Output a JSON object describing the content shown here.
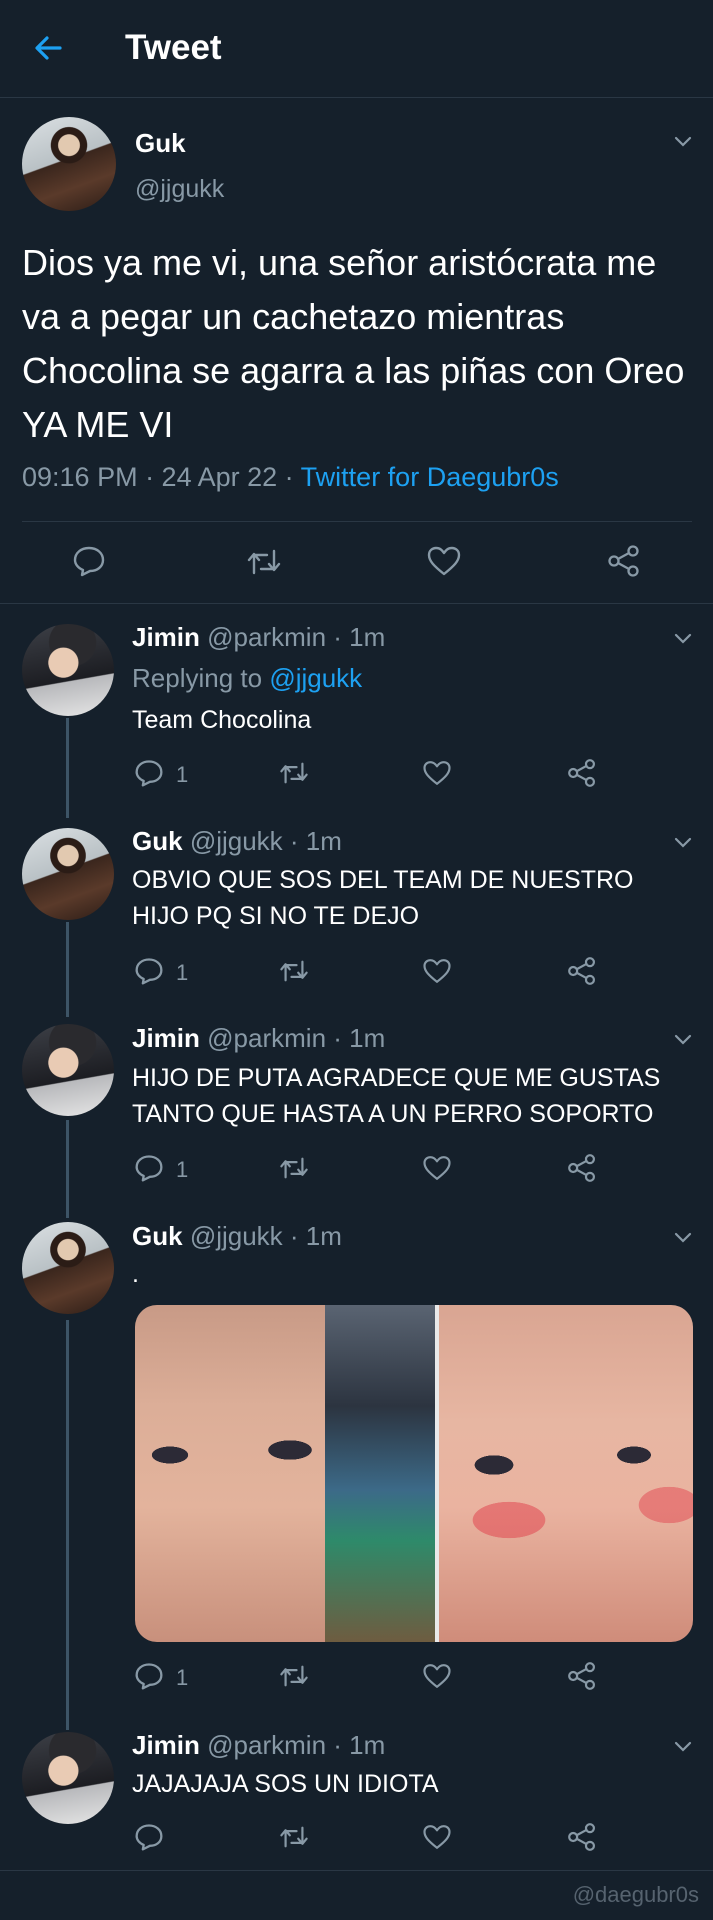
{
  "header": {
    "title": "Tweet",
    "back_icon": "back-arrow-icon"
  },
  "colors": {
    "background": "#15202b",
    "accent": "#1da1f2",
    "muted": "#8899a6",
    "divider": "#2a3744"
  },
  "main_tweet": {
    "name": "Guk",
    "handle": "@jjgukk",
    "text": "Dios ya me vi, una señor aristócrata me va a pegar un cachetazo mientras Chocolina se agarra a las piñas con Oreo YA ME VI",
    "time": "09:16 PM · 24 Apr 22 · ",
    "source": "Twitter for Daegubr0s"
  },
  "replies": [
    {
      "name": "Jimin",
      "meta": "@parkmin · 1m",
      "replying_label": "Replying to ",
      "replying_handle": "@jjgukk",
      "text": "Team Chocolina",
      "reply_count": "1"
    },
    {
      "name": "Guk",
      "meta": "@jjgukk · 1m",
      "text_line1": "OBVIO QUE SOS DEL TEAM DE NUESTRO",
      "text_line2": "HIJO PQ SI NO TE DEJO",
      "reply_count": "1"
    },
    {
      "name": "Jimin",
      "meta": "@parkmin · 1m",
      "text_line1": "HIJO DE PUTA AGRADECE QUE ME GUSTAS",
      "text_line2": "TANTO QUE HASTA A UN PERRO SOPORTO",
      "reply_count": "1"
    },
    {
      "name": "Guk",
      "meta": "@jjgukk · 1m",
      "text": ".",
      "reply_count": "1"
    },
    {
      "name": "Jimin",
      "meta": "@parkmin · 1m",
      "text": "JAJAJAJA SOS UN IDIOTA",
      "reply_count": ""
    }
  ],
  "watermark": "@daegubr0s"
}
